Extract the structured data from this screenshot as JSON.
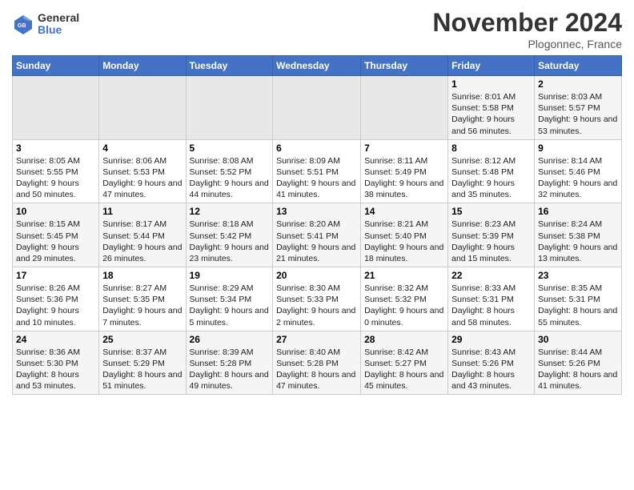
{
  "header": {
    "logo_text_line1": "General",
    "logo_text_line2": "Blue",
    "month": "November 2024",
    "location": "Plogonnec, France"
  },
  "calendar": {
    "days_of_week": [
      "Sunday",
      "Monday",
      "Tuesday",
      "Wednesday",
      "Thursday",
      "Friday",
      "Saturday"
    ],
    "weeks": [
      [
        {
          "day": "",
          "info": ""
        },
        {
          "day": "",
          "info": ""
        },
        {
          "day": "",
          "info": ""
        },
        {
          "day": "",
          "info": ""
        },
        {
          "day": "",
          "info": ""
        },
        {
          "day": "1",
          "info": "Sunrise: 8:01 AM\nSunset: 5:58 PM\nDaylight: 9 hours and 56 minutes."
        },
        {
          "day": "2",
          "info": "Sunrise: 8:03 AM\nSunset: 5:57 PM\nDaylight: 9 hours and 53 minutes."
        }
      ],
      [
        {
          "day": "3",
          "info": "Sunrise: 8:05 AM\nSunset: 5:55 PM\nDaylight: 9 hours and 50 minutes."
        },
        {
          "day": "4",
          "info": "Sunrise: 8:06 AM\nSunset: 5:53 PM\nDaylight: 9 hours and 47 minutes."
        },
        {
          "day": "5",
          "info": "Sunrise: 8:08 AM\nSunset: 5:52 PM\nDaylight: 9 hours and 44 minutes."
        },
        {
          "day": "6",
          "info": "Sunrise: 8:09 AM\nSunset: 5:51 PM\nDaylight: 9 hours and 41 minutes."
        },
        {
          "day": "7",
          "info": "Sunrise: 8:11 AM\nSunset: 5:49 PM\nDaylight: 9 hours and 38 minutes."
        },
        {
          "day": "8",
          "info": "Sunrise: 8:12 AM\nSunset: 5:48 PM\nDaylight: 9 hours and 35 minutes."
        },
        {
          "day": "9",
          "info": "Sunrise: 8:14 AM\nSunset: 5:46 PM\nDaylight: 9 hours and 32 minutes."
        }
      ],
      [
        {
          "day": "10",
          "info": "Sunrise: 8:15 AM\nSunset: 5:45 PM\nDaylight: 9 hours and 29 minutes."
        },
        {
          "day": "11",
          "info": "Sunrise: 8:17 AM\nSunset: 5:44 PM\nDaylight: 9 hours and 26 minutes."
        },
        {
          "day": "12",
          "info": "Sunrise: 8:18 AM\nSunset: 5:42 PM\nDaylight: 9 hours and 23 minutes."
        },
        {
          "day": "13",
          "info": "Sunrise: 8:20 AM\nSunset: 5:41 PM\nDaylight: 9 hours and 21 minutes."
        },
        {
          "day": "14",
          "info": "Sunrise: 8:21 AM\nSunset: 5:40 PM\nDaylight: 9 hours and 18 minutes."
        },
        {
          "day": "15",
          "info": "Sunrise: 8:23 AM\nSunset: 5:39 PM\nDaylight: 9 hours and 15 minutes."
        },
        {
          "day": "16",
          "info": "Sunrise: 8:24 AM\nSunset: 5:38 PM\nDaylight: 9 hours and 13 minutes."
        }
      ],
      [
        {
          "day": "17",
          "info": "Sunrise: 8:26 AM\nSunset: 5:36 PM\nDaylight: 9 hours and 10 minutes."
        },
        {
          "day": "18",
          "info": "Sunrise: 8:27 AM\nSunset: 5:35 PM\nDaylight: 9 hours and 7 minutes."
        },
        {
          "day": "19",
          "info": "Sunrise: 8:29 AM\nSunset: 5:34 PM\nDaylight: 9 hours and 5 minutes."
        },
        {
          "day": "20",
          "info": "Sunrise: 8:30 AM\nSunset: 5:33 PM\nDaylight: 9 hours and 2 minutes."
        },
        {
          "day": "21",
          "info": "Sunrise: 8:32 AM\nSunset: 5:32 PM\nDaylight: 9 hours and 0 minutes."
        },
        {
          "day": "22",
          "info": "Sunrise: 8:33 AM\nSunset: 5:31 PM\nDaylight: 8 hours and 58 minutes."
        },
        {
          "day": "23",
          "info": "Sunrise: 8:35 AM\nSunset: 5:31 PM\nDaylight: 8 hours and 55 minutes."
        }
      ],
      [
        {
          "day": "24",
          "info": "Sunrise: 8:36 AM\nSunset: 5:30 PM\nDaylight: 8 hours and 53 minutes."
        },
        {
          "day": "25",
          "info": "Sunrise: 8:37 AM\nSunset: 5:29 PM\nDaylight: 8 hours and 51 minutes."
        },
        {
          "day": "26",
          "info": "Sunrise: 8:39 AM\nSunset: 5:28 PM\nDaylight: 8 hours and 49 minutes."
        },
        {
          "day": "27",
          "info": "Sunrise: 8:40 AM\nSunset: 5:28 PM\nDaylight: 8 hours and 47 minutes."
        },
        {
          "day": "28",
          "info": "Sunrise: 8:42 AM\nSunset: 5:27 PM\nDaylight: 8 hours and 45 minutes."
        },
        {
          "day": "29",
          "info": "Sunrise: 8:43 AM\nSunset: 5:26 PM\nDaylight: 8 hours and 43 minutes."
        },
        {
          "day": "30",
          "info": "Sunrise: 8:44 AM\nSunset: 5:26 PM\nDaylight: 8 hours and 41 minutes."
        }
      ]
    ]
  }
}
